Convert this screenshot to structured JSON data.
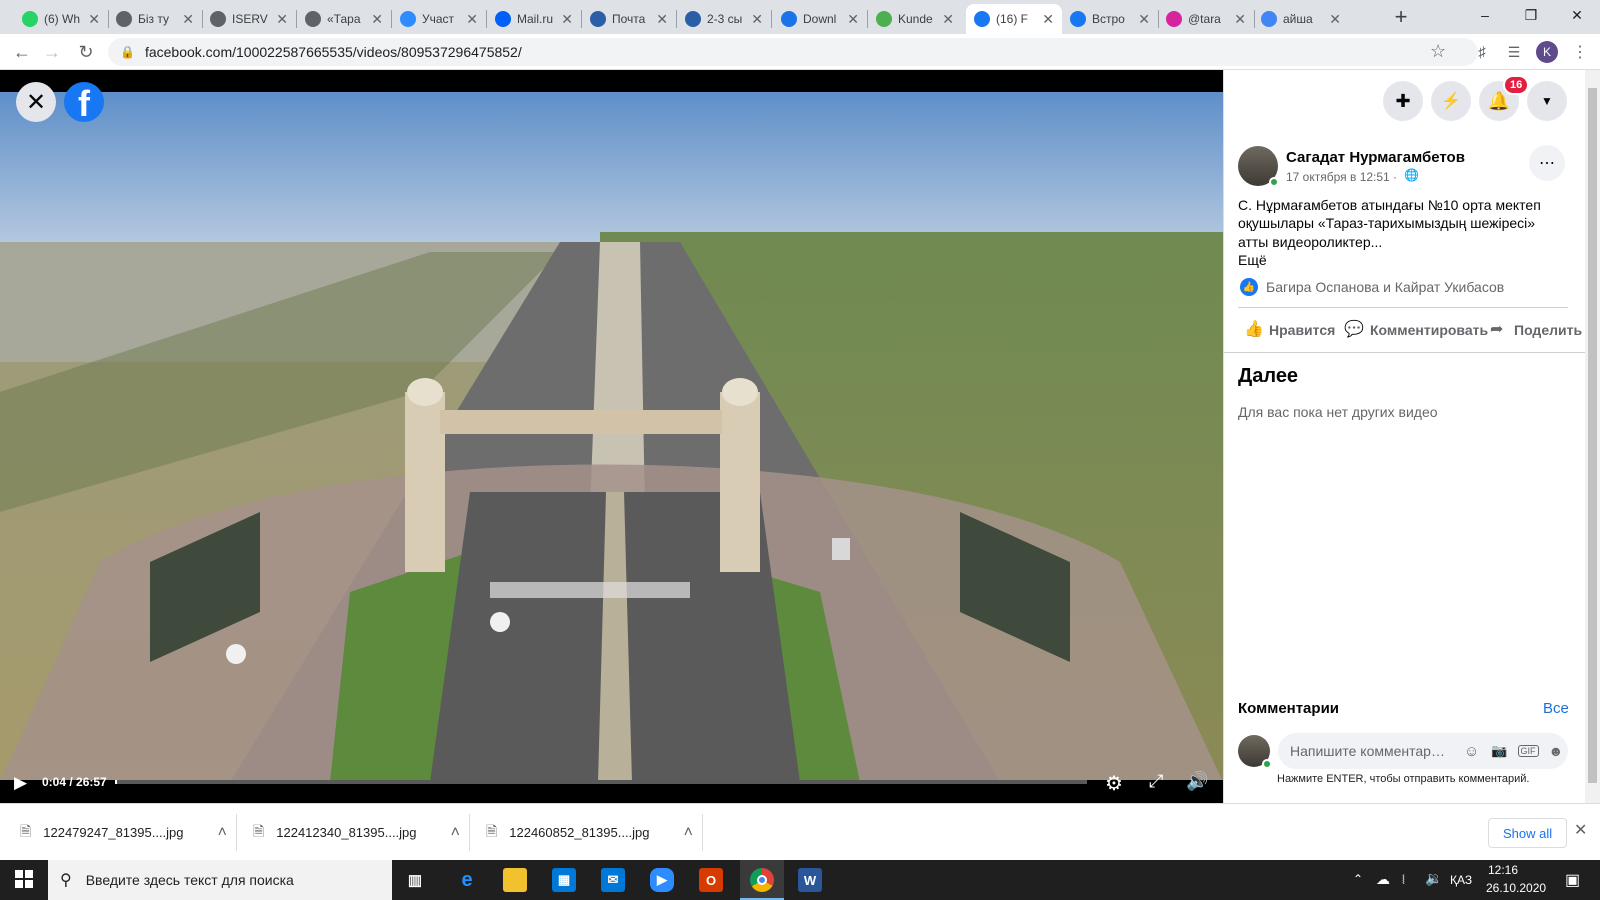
{
  "browser": {
    "tabs": [
      {
        "title": "(6) Wh",
        "icon": "whatsapp-icon",
        "color": "#25d366"
      },
      {
        "title": "Біз ту",
        "icon": "globe-icon",
        "color": "#5f6368"
      },
      {
        "title": "ISERV",
        "icon": "globe-icon",
        "color": "#5f6368"
      },
      {
        "title": "«Тара",
        "icon": "globe-icon",
        "color": "#5f6368"
      },
      {
        "title": "Участ",
        "icon": "zoom-icon",
        "color": "#2d8cff"
      },
      {
        "title": "Mail.ru",
        "icon": "mailru-icon",
        "color": "#005ff9"
      },
      {
        "title": "Почта",
        "icon": "mail-icon",
        "color": "#2a5ea7"
      },
      {
        "title": "2-3 сы",
        "icon": "mail-icon",
        "color": "#2a5ea7"
      },
      {
        "title": "Downl",
        "icon": "download-icon",
        "color": "#1a73e8"
      },
      {
        "title": "Kunde",
        "icon": "kundelik-icon",
        "color": "#4caf50"
      },
      {
        "title": "(16) F",
        "icon": "facebook-icon",
        "color": "#1877f2"
      },
      {
        "title": "Встро",
        "icon": "facebook-icon",
        "color": "#1877f2"
      },
      {
        "title": "@tara",
        "icon": "instagram-icon",
        "color": "#d6249f"
      },
      {
        "title": "айша",
        "icon": "google-icon",
        "color": "#4285f4"
      }
    ],
    "new_tab": "+",
    "url": "facebook.com/100022587665535/videos/809537296475852/",
    "profile_initial": "K"
  },
  "video": {
    "current_time": "0:04",
    "duration": "26:57",
    "time_display": "0:04 / 26:57",
    "progress": 0.0025
  },
  "header": {
    "notification_count": "16"
  },
  "post": {
    "author": "Сагадат Нурмагамбетов",
    "date": "17 октября в 12:51 ·",
    "text_lines": [
      "С. Нұрмағамбетов атындағы №10 орта мектеп",
      "оқушылары «Тараз-тарихымыздың шежіресі»",
      "атты видеороликтер..."
    ],
    "more": "Ещё",
    "reactions": "Багира Оспанова и Кайрат Укибасов",
    "like": "Нравится",
    "comment": "Комментировать",
    "share": "Поделиться"
  },
  "next": {
    "title": "Далее",
    "empty": "Для вас пока нет других видео"
  },
  "comments": {
    "title": "Комментарии",
    "all": "Все",
    "placeholder": "Напишите комментарий...",
    "hint": "Нажмите ENTER, чтобы отправить комментарий."
  },
  "downloads": {
    "items": [
      "122479247_81395....jpg",
      "122412340_81395....jpg",
      "122460852_81395....jpg"
    ],
    "show_all": "Show all"
  },
  "taskbar": {
    "search": "Введите здесь текст для поиска",
    "lang": "ҚАЗ",
    "time": "12:16",
    "date": "26.10.2020"
  }
}
